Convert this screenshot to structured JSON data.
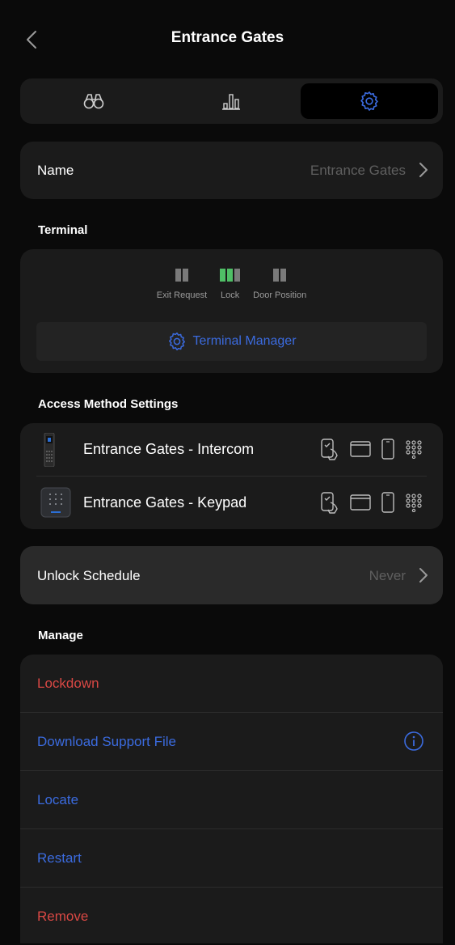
{
  "header": {
    "title": "Entrance Gates",
    "back_icon": "chevron-left-icon"
  },
  "tabs": [
    {
      "icon": "binoculars-icon",
      "active": false
    },
    {
      "icon": "bar-chart-icon",
      "active": false
    },
    {
      "icon": "gear-icon",
      "active": true
    }
  ],
  "name_row": {
    "label": "Name",
    "value": "Entrance Gates"
  },
  "terminal": {
    "section_label": "Terminal",
    "statuses": [
      {
        "label": "Exit Request",
        "color": "#7a7a7a"
      },
      {
        "label": "Lock",
        "color": "#4fbf66"
      },
      {
        "label": "Door Position",
        "color": "#7a7a7a"
      }
    ],
    "manager_button": "Terminal Manager"
  },
  "access": {
    "section_label": "Access Method Settings",
    "items": [
      {
        "name": "Entrance Gates - Intercom",
        "methods": [
          "nfc-phone-icon",
          "card-icon",
          "mobile-icon",
          "pin-icon"
        ]
      },
      {
        "name": "Entrance Gates - Keypad",
        "methods": [
          "nfc-phone-icon",
          "card-icon",
          "mobile-icon",
          "pin-icon"
        ]
      }
    ]
  },
  "schedule": {
    "label": "Unlock Schedule",
    "value": "Never"
  },
  "manage": {
    "section_label": "Manage",
    "items": [
      {
        "label": "Lockdown",
        "color": "#d94844"
      },
      {
        "label": "Download Support File",
        "color": "#3b6bdf",
        "icon": "info-icon"
      },
      {
        "label": "Locate",
        "color": "#3b6bdf"
      },
      {
        "label": "Restart",
        "color": "#3b6bdf"
      },
      {
        "label": "Remove",
        "color": "#d94844"
      }
    ]
  },
  "colors": {
    "background": "#0a0a0a",
    "card": "#1b1b1b",
    "accent_blue": "#3b6bdf",
    "danger_red": "#d94844",
    "active_green": "#4fbf66"
  }
}
